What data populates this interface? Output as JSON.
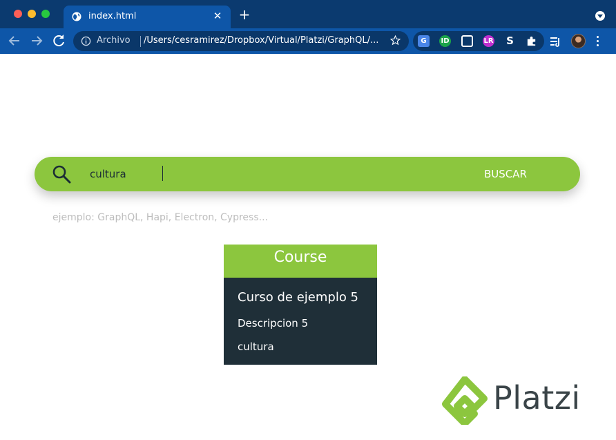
{
  "browser": {
    "tab": {
      "title": "index.html",
      "favicon": "globe-icon"
    },
    "address": {
      "security_label": "Archivo",
      "url": "/Users/cesramirez/Dropbox/Virtual/Platzi/GraphQL/..."
    },
    "extensions": [
      {
        "name": "google-translate-icon",
        "text": "G"
      },
      {
        "name": "id-extension-icon",
        "text": "ID"
      },
      {
        "name": "box-extension-icon",
        "text": ""
      },
      {
        "name": "lr-extension-icon",
        "text": "LR"
      },
      {
        "name": "s-extension-icon",
        "text": "S"
      },
      {
        "name": "puzzle-icon",
        "text": ""
      }
    ],
    "colors": {
      "frame": "#0b3a6f",
      "toolbar": "#0e56a8"
    }
  },
  "search": {
    "value": "cultura",
    "button_label": "BUSCAR",
    "hint": "ejemplo: GraphQL, Hapi, Electron, Cypress..."
  },
  "result": {
    "type_label": "Course",
    "title": "Curso de ejemplo 5",
    "description": "Descripcion 5",
    "topic": "cultura"
  },
  "brand": {
    "name": "Platzi",
    "accent": "#8cc63e",
    "dark": "#1f2f38"
  }
}
